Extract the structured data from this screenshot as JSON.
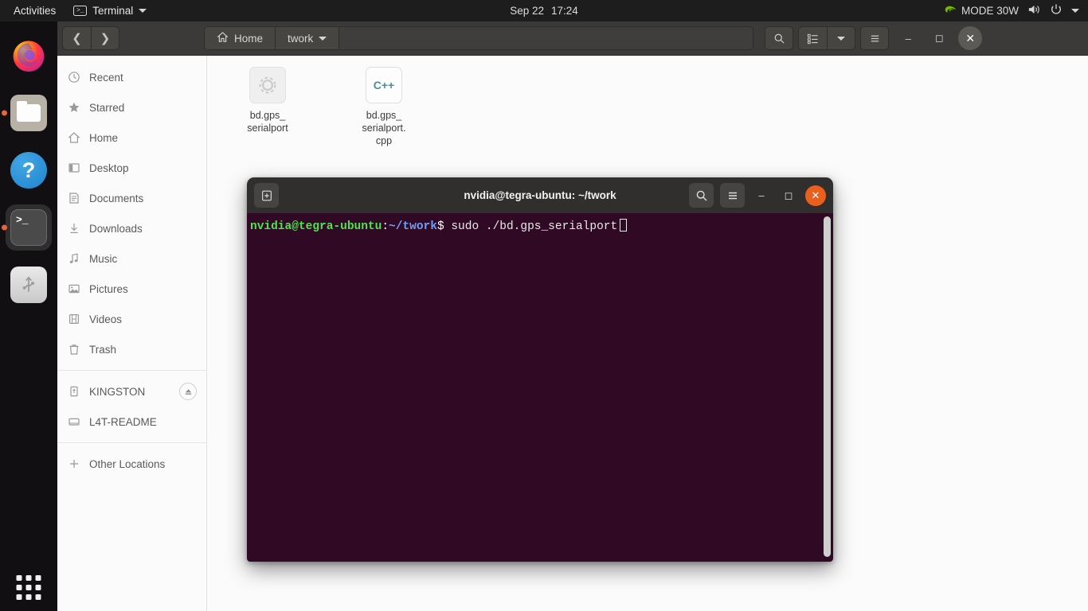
{
  "topbar": {
    "activities": "Activities",
    "app_menu": {
      "label": "Terminal",
      "icon": "terminal-icon"
    },
    "clock": {
      "date": "Sep 22",
      "time": "17:24"
    },
    "indicators": {
      "nvidia_label": "MODE 30W",
      "nvidia_icon": "nvidia-logo-icon",
      "volume_icon": "volume-icon",
      "power_icon": "power-icon",
      "menu_icon": "chevron-down-icon"
    }
  },
  "dock": {
    "items": [
      {
        "name": "firefox",
        "icon": "firefox-icon",
        "running": false,
        "active": false
      },
      {
        "name": "files",
        "icon": "files-folder-icon",
        "running": true,
        "active": false
      },
      {
        "name": "help",
        "icon": "help-question-icon",
        "glyph": "?",
        "running": false,
        "active": false
      },
      {
        "name": "terminal",
        "icon": "terminal-icon",
        "glyph": ">_",
        "running": true,
        "active": true
      },
      {
        "name": "usb-drive",
        "icon": "usb-icon",
        "running": false,
        "active": false
      }
    ],
    "show_apps": "show-applications-grid-icon"
  },
  "file_manager": {
    "header": {
      "back_icon": "chevron-left-icon",
      "forward_icon": "chevron-right-icon",
      "breadcrumbs": [
        {
          "label": "Home",
          "icon": "home-icon"
        },
        {
          "label": "twork",
          "icon": "chevron-down-icon"
        }
      ],
      "search_icon": "search-icon",
      "view_list_icon": "list-view-icon",
      "view_dropdown_icon": "chevron-down-icon",
      "menu_icon": "hamburger-menu-icon",
      "minimize_icon": "minimize-icon",
      "maximize_icon": "maximize-icon",
      "close_icon": "close-icon"
    },
    "sidebar": {
      "items": [
        {
          "label": "Recent",
          "icon": "clock-icon"
        },
        {
          "label": "Starred",
          "icon": "star-icon"
        },
        {
          "label": "Home",
          "icon": "home-icon"
        },
        {
          "label": "Desktop",
          "icon": "desktop-icon"
        },
        {
          "label": "Documents",
          "icon": "documents-icon"
        },
        {
          "label": "Downloads",
          "icon": "download-icon"
        },
        {
          "label": "Music",
          "icon": "music-note-icon"
        },
        {
          "label": "Pictures",
          "icon": "picture-icon"
        },
        {
          "label": "Videos",
          "icon": "video-film-icon"
        },
        {
          "label": "Trash",
          "icon": "trash-icon"
        }
      ],
      "devices": [
        {
          "label": "KINGSTON",
          "icon": "usb-drive-icon",
          "eject_icon": "eject-icon"
        },
        {
          "label": "L4T-README",
          "icon": "disc-icon"
        }
      ],
      "other": {
        "label": "Other Locations",
        "icon": "plus-icon"
      }
    },
    "files": [
      {
        "name": "bd.gps_\nserialport",
        "type": "executable",
        "icon": "gear-executable-icon"
      },
      {
        "name": "bd.gps_\nserialport.\ncpp",
        "type": "cpp-source",
        "icon": "cpp-file-icon",
        "badge": "C++"
      }
    ]
  },
  "terminal": {
    "title": "nvidia@tegra-ubuntu: ~/twork",
    "new_tab_icon": "new-tab-icon",
    "search_icon": "search-icon",
    "menu_icon": "hamburger-menu-icon",
    "minimize_icon": "minimize-icon",
    "maximize_icon": "maximize-icon",
    "close_icon": "close-icon",
    "prompt": {
      "user_host": "nvidia@tegra-ubuntu",
      "colon": ":",
      "path": "~/twork",
      "dollar": "$",
      "command": " sudo ./bd.gps_serialport"
    },
    "colors": {
      "background": "#300a24",
      "user_host": "#4ee44e",
      "path": "#6ca0f8",
      "text": "#e8e8e8",
      "close_button": "#e8601c"
    }
  }
}
